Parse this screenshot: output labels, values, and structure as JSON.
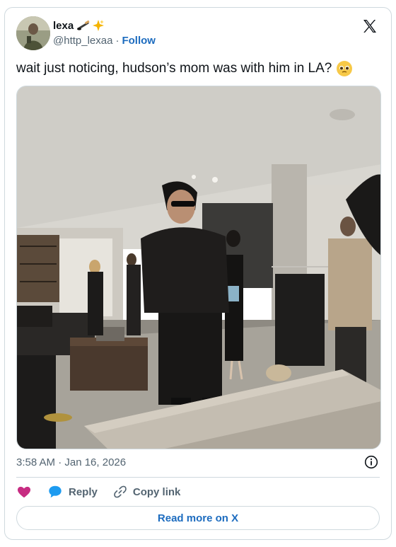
{
  "author": {
    "name": "lexa",
    "name_emojis": [
      "hockey-stick-emoji",
      "sparkles-emoji"
    ],
    "handle": "@http_lexaa",
    "separator": "·",
    "follow_label": "Follow"
  },
  "brand_logo": "x-logo",
  "tweet": {
    "text": "wait just noticing, hudson’s mom was with him in LA?",
    "emoji": "pleading-face-emoji",
    "photo": "photo of a man in a black leather outfit and sunglasses standing in a living room, with several people behind him"
  },
  "meta": {
    "timestamp": "3:58 AM · Jan 16, 2026",
    "info_icon": "info-icon"
  },
  "actions": {
    "like_icon": "heart-icon",
    "reply_label": "Reply",
    "reply_icon": "speech-bubble-icon",
    "copy_label": "Copy link",
    "copy_icon": "link-icon"
  },
  "read_more_label": "Read more on X",
  "colors": {
    "link_blue": "#1d6cbf",
    "heart_pink": "#c72c82",
    "reply_blue": "#1d9bf0",
    "secondary_text": "#536471",
    "border": "#cfd9de"
  }
}
